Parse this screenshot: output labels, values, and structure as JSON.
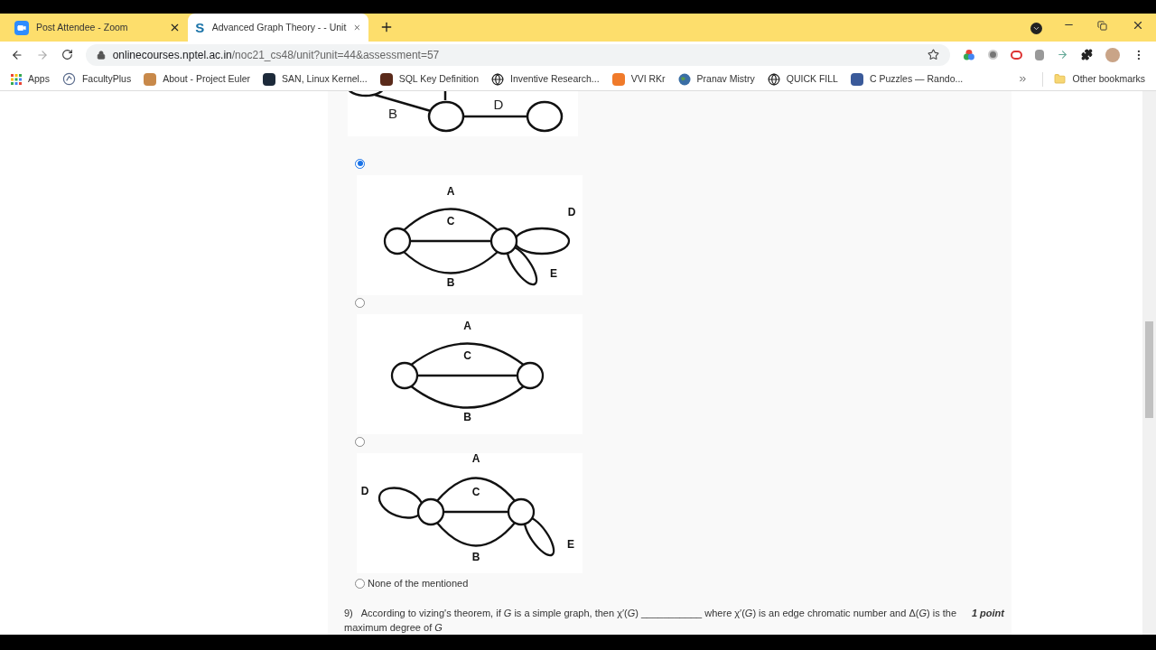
{
  "tabs": [
    {
      "title": "Post Attendee - Zoom",
      "selected": false
    },
    {
      "title": "Advanced Graph Theory - - Unit",
      "icon_text": "S",
      "selected": true
    }
  ],
  "address": {
    "host": "onlinecourses.nptel.ac.in",
    "path": "/noc21_cs48/unit?unit=44&assessment=57"
  },
  "bookmarks": [
    {
      "label": "Apps"
    },
    {
      "label": "FacultyPlus"
    },
    {
      "label": "About - Project Euler"
    },
    {
      "label": "SAN, Linux Kernel..."
    },
    {
      "label": "SQL Key Definition"
    },
    {
      "label": "Inventive Research..."
    },
    {
      "label": "VVI RKr"
    },
    {
      "label": "Pranav Mistry"
    },
    {
      "label": "QUICK FILL"
    },
    {
      "label": "C Puzzles — Rando..."
    }
  ],
  "other_bookmarks": "Other bookmarks",
  "previous_figure": {
    "labels": [
      "B",
      "D"
    ]
  },
  "options": [
    {
      "kind": "graph",
      "selected": true,
      "edges": {
        "top": "A",
        "middle": "C",
        "bottom": "B"
      },
      "loop_labels": [
        "D",
        "E"
      ]
    },
    {
      "kind": "graph",
      "selected": false,
      "edges": {
        "top": "A",
        "middle": "C",
        "bottom": "B"
      }
    },
    {
      "kind": "graph",
      "selected": false,
      "edges": {
        "top": "A",
        "middle": "C",
        "bottom": "B"
      },
      "loop_labels": [
        "D",
        "E"
      ]
    },
    {
      "kind": "text",
      "selected": false,
      "label": "None of the mentioned"
    }
  ],
  "next_question": {
    "number": "9)",
    "text": "According to vizing's theorem, if *G* is a simple graph, then χ′(*G*) ___________ where χ′(*G*) is an edge chromatic number and Δ(*G*) is the maximum degree of *G*",
    "points": "1 point"
  }
}
